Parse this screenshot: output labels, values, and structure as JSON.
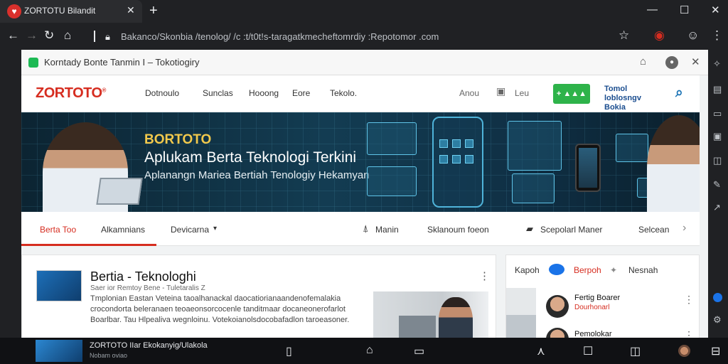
{
  "browser": {
    "tab_title": "ZORTOTU Bilandit",
    "tab_icon": "brand-logo-icon",
    "url": "Bakanco/Skonbia /onolog/ /c :t/t0tls-taragatkmecheftomrdiy.:Repotomor .com",
    "url_prefix": "Bakanco/Skonbia /tenolog/ /c :t/t0t!s-taragatkmecheftomrdiy :Repotomor .com"
  },
  "inner_window": {
    "title": "Korntady Bonte Tanmin I – Tokotiogiry"
  },
  "site": {
    "logo": "ZORTOTO",
    "logo_mark": "®",
    "nav": [
      "Dotnoulo",
      "Sunclas",
      "Hooong",
      "Eore",
      "Tekolo."
    ],
    "util": {
      "about": "Anou",
      "lang": "Leu"
    },
    "download_label": "+ ▲▲▲",
    "app_link": "Tomol loblosngv Bokia",
    "accent": "#d62d20",
    "download_color": "#2eb34a"
  },
  "hero": {
    "brand": "BORTOTO",
    "title": "Aplukam Berta Teknologi Terkini",
    "subtitle": "Aplanangn Mariea Bertiah Tenologiy Hekamyan"
  },
  "content_tabs": {
    "tabs": [
      "Berta Too",
      "Alkamnians",
      "Devicarna"
    ],
    "dropdown_caret": "▾",
    "right": [
      "Manin",
      "Sklanoum foeon",
      "Scepolarl Maner",
      "Selcean"
    ]
  },
  "article": {
    "title": "Bertia - Teknologhi",
    "meta": "Saer ior  Remtoy Bene -  Tuletaralis Z",
    "text": "Tmplonian Eastan Veteina taoalhanackal daocatiorianaandenofemalakia crocondorta beleranaen teoaeonsorcocenle tanditmaar docaneonerofarlot Boarlbar. Tau Hlpealiva wegnloinu. Votekoianolsdocobafadlon taroeasoner."
  },
  "sidebar": {
    "tabs": [
      "Kapoh",
      "Berpoh",
      "Nesnah"
    ],
    "items": [
      {
        "name": "Fertig Boarer",
        "sub": "Dourhonarl"
      },
      {
        "name": "Pemolokar",
        "sub": ""
      }
    ]
  },
  "taskbar": {
    "title": "ZORTOTO IIar Ekokanyig/Ulakola",
    "subtitle": "Nobam oviao"
  }
}
